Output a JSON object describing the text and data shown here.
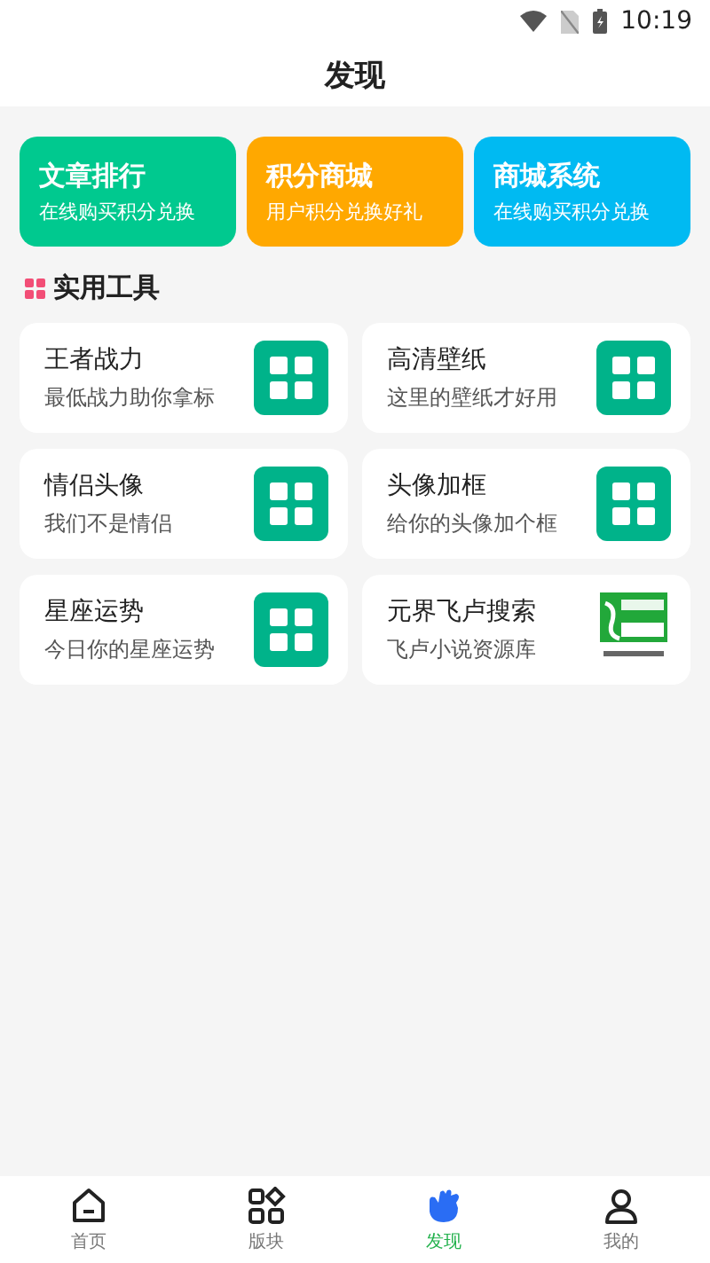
{
  "status_bar": {
    "time": "10:19"
  },
  "header": {
    "title": "发现"
  },
  "banners": [
    {
      "title": "文章排行",
      "subtitle": "在线购买积分兑换",
      "color": "#00c98f"
    },
    {
      "title": "积分商城",
      "subtitle": "用户积分兑换好礼",
      "color": "#ffa800"
    },
    {
      "title": "商城系统",
      "subtitle": "在线购买积分兑换",
      "color": "#00baf2"
    }
  ],
  "section": {
    "title": "实用工具"
  },
  "tools": [
    {
      "title": "王者战力",
      "subtitle": "最低战力助你拿标",
      "kind": "grid"
    },
    {
      "title": "高清壁纸",
      "subtitle": "这里的壁纸才好用",
      "kind": "grid"
    },
    {
      "title": "情侣头像",
      "subtitle": "我们不是情侣",
      "kind": "grid"
    },
    {
      "title": "头像加框",
      "subtitle": "给你的头像加个框",
      "kind": "grid"
    },
    {
      "title": "星座运势",
      "subtitle": "今日你的星座运势",
      "kind": "grid"
    },
    {
      "title": "元界飞卢搜索",
      "subtitle": "飞卢小说资源库",
      "kind": "logo"
    }
  ],
  "tab_bar": [
    {
      "label": "首页",
      "kind": "home",
      "selected": false
    },
    {
      "label": "版块",
      "kind": "blocks",
      "selected": false
    },
    {
      "label": "发现",
      "kind": "discover",
      "selected": true
    },
    {
      "label": "我的",
      "kind": "user",
      "selected": false
    }
  ]
}
